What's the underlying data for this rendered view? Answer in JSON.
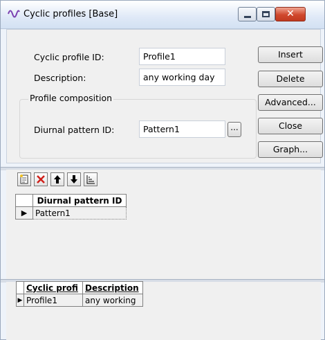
{
  "window": {
    "title": "Cyclic profiles [Base]",
    "controls": {
      "close_glyph": "✕"
    }
  },
  "form": {
    "cyclic_profile_id_label": "Cyclic profile ID:",
    "cyclic_profile_id_value": "Profile1",
    "description_label": "Description:",
    "description_value": "any working day",
    "group_label": "Profile composition",
    "diurnal_pattern_label": "Diurnal pattern ID:",
    "diurnal_pattern_value": "Pattern1",
    "browse_label": "..."
  },
  "buttons": {
    "insert": "Insert",
    "delete": "Delete",
    "advanced": "Advanced...",
    "close": "Close",
    "graph": "Graph..."
  },
  "pattern_grid": {
    "header": "Diurnal pattern ID",
    "rows": [
      "Pattern1"
    ]
  },
  "profile_grid": {
    "headers": [
      "Cyclic profi",
      "Description"
    ],
    "rows": [
      [
        "Profile1",
        "any working"
      ]
    ]
  },
  "colors": {
    "accent_close": "#c23a20",
    "window_bg": "#eef3fa",
    "panel_bg": "#f0f0f0"
  },
  "icons": [
    "wave-icon",
    "new-row-icon",
    "delete-row-icon",
    "move-up-icon",
    "move-down-icon",
    "sort-icon"
  ]
}
